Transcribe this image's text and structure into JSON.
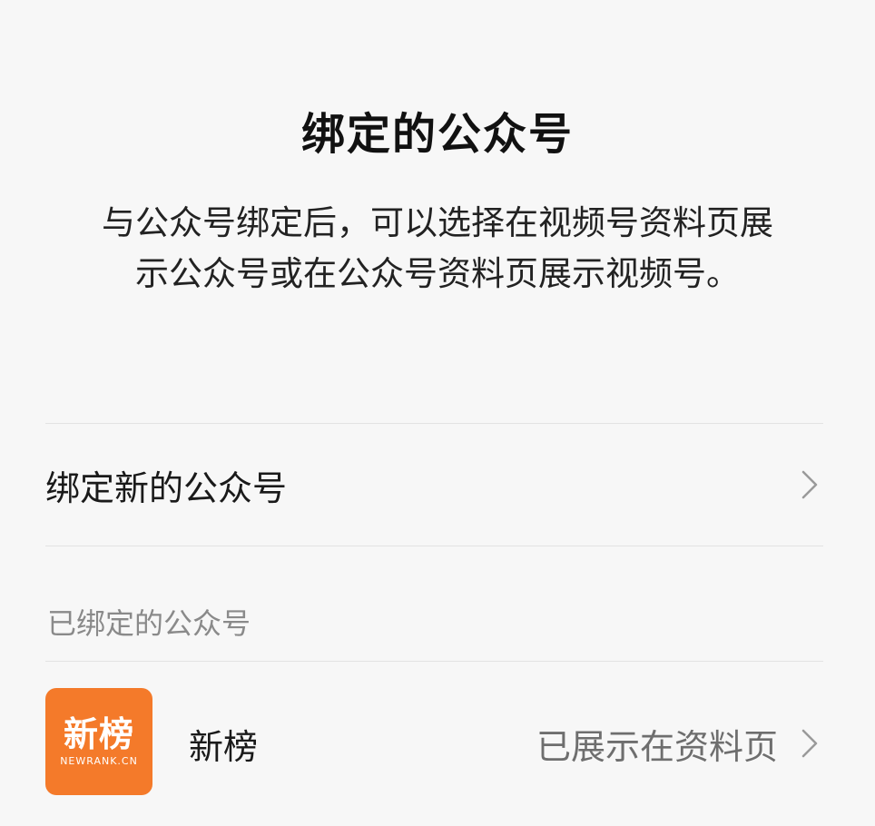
{
  "header": {
    "title": "绑定的公众号"
  },
  "description": {
    "line1": "与公众号绑定后，可以选择在视频号资料页展",
    "line2": "示公众号或在公众号资料页展示视频号。"
  },
  "bind_new": {
    "label": "绑定新的公众号"
  },
  "bound_section": {
    "label": "已绑定的公众号",
    "accounts": [
      {
        "name": "新榜",
        "logo_text": "新榜",
        "logo_subtext": "NEWRANK.CN",
        "status": "已展示在资料页"
      }
    ]
  },
  "colors": {
    "background": "#f7f7f7",
    "logo_bg": "#f47a2a",
    "muted_text": "#8a8a8a"
  }
}
